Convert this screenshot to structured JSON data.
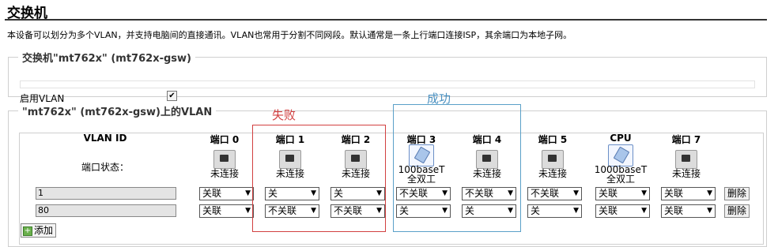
{
  "page": {
    "title": "交换机",
    "description": "本设备可以划分为多个VLAN，并支持电脑间的直接通讯。VLAN也常用于分割不同网段。默认通常是一条上行端口连接ISP，其余端口为本地子网。"
  },
  "switch_section": {
    "legend": "交换机\"mt762x\" (mt762x-gsw)",
    "enable_vlan_label": "启用VLAN",
    "enable_vlan_checked": true,
    "enable_vlan_mark": "✔"
  },
  "vlan_section": {
    "legend": "\"mt762x\" (mt762x-gsw)上的VLAN",
    "vlan_id_header": "VLAN ID",
    "port_state_label": "端口状态：",
    "ports": [
      {
        "name": "端口 0",
        "status": "未连接",
        "icon": "ethernet-port-icon"
      },
      {
        "name": "端口 1",
        "status": "未连接",
        "icon": "ethernet-port-icon"
      },
      {
        "name": "端口 2",
        "status": "未连接",
        "icon": "ethernet-port-icon"
      },
      {
        "name": "端口 3",
        "status": "100baseT 全双工",
        "status_line1": "100baseT",
        "status_line2": "全双工",
        "icon": "ethernet-port-connected-icon"
      },
      {
        "name": "端口 4",
        "status": "未连接",
        "icon": "ethernet-port-icon"
      },
      {
        "name": "端口 5",
        "status": "未连接",
        "icon": "ethernet-port-icon"
      },
      {
        "name": "CPU",
        "status": "1000baseT 全双工",
        "status_line1": "1000baseT",
        "status_line2": "全双工",
        "icon": "ethernet-port-connected-icon"
      },
      {
        "name": "端口 7",
        "status": "未连接",
        "icon": "ethernet-port-icon"
      }
    ],
    "rows": [
      {
        "vlan_id": "1",
        "selects": [
          "关联",
          "关",
          "关",
          "不关联",
          "不关联",
          "不关联",
          "关联",
          "关联"
        ],
        "delete_label": "删除"
      },
      {
        "vlan_id": "80",
        "selects": [
          "关联",
          "不关联",
          "不关联",
          "关",
          "关",
          "关",
          "关联",
          "关联"
        ],
        "delete_label": "删除"
      }
    ],
    "add_label": "添加"
  },
  "annotations": {
    "fail_label": "失败",
    "fail_color": "#d24040",
    "success_label": "成功",
    "success_color": "#4a90c0"
  }
}
